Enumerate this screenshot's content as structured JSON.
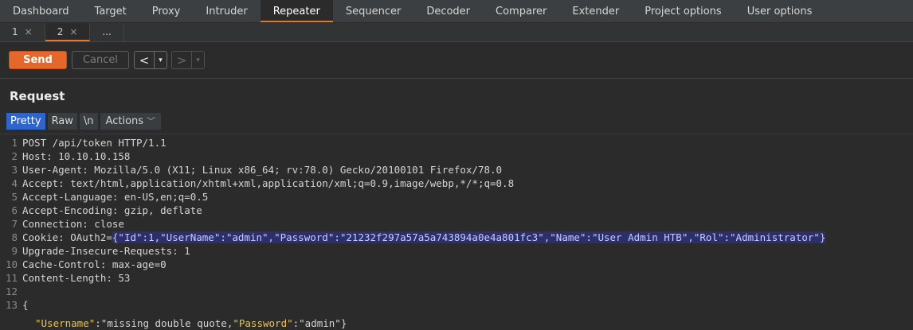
{
  "main_tabs": [
    "Dashboard",
    "Target",
    "Proxy",
    "Intruder",
    "Repeater",
    "Sequencer",
    "Decoder",
    "Comparer",
    "Extender",
    "Project options",
    "User options"
  ],
  "active_tab": "Repeater",
  "sub_tabs": [
    {
      "label": "1",
      "close": "×"
    },
    {
      "label": "2",
      "close": "×"
    },
    {
      "label": "...",
      "close": ""
    }
  ],
  "toolbar": {
    "send_label": "Send",
    "cancel_label": "Cancel",
    "back_arrow": "<",
    "forward_arrow": ">",
    "dropdown_glyph": "▾"
  },
  "request": {
    "title": "Request",
    "view_buttons": [
      "Pretty",
      "Raw",
      "\\n"
    ],
    "actions_label": "Actions",
    "lines": [
      {
        "n": "1",
        "text": "POST /api/token HTTP/1.1"
      },
      {
        "n": "2",
        "text": "Host: 10.10.10.158"
      },
      {
        "n": "3",
        "text": "User-Agent: Mozilla/5.0 (X11; Linux x86_64; rv:78.0) Gecko/20100101 Firefox/78.0"
      },
      {
        "n": "4",
        "text": "Accept: text/html,application/xhtml+xml,application/xml;q=0.9,image/webp,*/*;q=0.8"
      },
      {
        "n": "5",
        "text": "Accept-Language: en-US,en;q=0.5"
      },
      {
        "n": "6",
        "text": "Accept-Encoding: gzip, deflate"
      },
      {
        "n": "7",
        "text": "Connection: close"
      },
      {
        "n": "8",
        "text": "Cookie: OAuth2=",
        "highlight": "{\"Id\":1,\"UserName\":\"admin\",\"Password\":\"21232f297a57a5a743894a0e4a801fc3\",\"Name\":\"User Admin HTB\",\"Rol\":\"Administrator\"}"
      },
      {
        "n": "9",
        "text": "Upgrade-Insecure-Requests: 1"
      },
      {
        "n": "10",
        "text": "Cache-Control: max-age=0"
      },
      {
        "n": "11",
        "text": "Content-Length: 53"
      },
      {
        "n": "12",
        "text": ""
      },
      {
        "n": "13",
        "text": "{"
      }
    ],
    "body_line": {
      "key1": "\"Username\"",
      "sep1": ":\"missing double quote,",
      "key2": "\"Password\"",
      "sep2": ":\"admin\"}"
    }
  },
  "colors": {
    "accent": "#e4672b",
    "active_view": "#2f65ca",
    "highlight": "#2c2f6b"
  }
}
